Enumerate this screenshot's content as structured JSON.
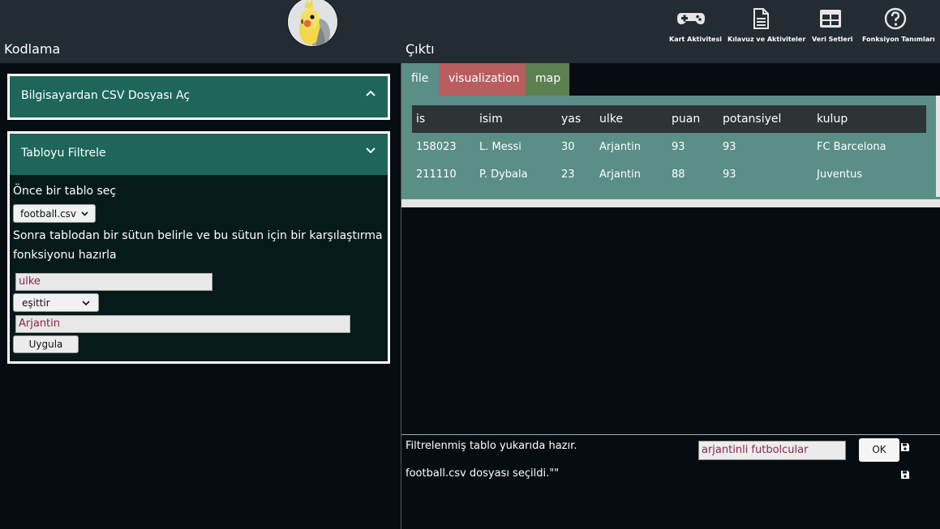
{
  "header": {
    "left_title": "Kodlama",
    "right_title": "Çıktı",
    "nav": [
      {
        "label": "Kart Aktivitesi",
        "icon": "gamepad-icon"
      },
      {
        "label": "Kılavuz ve Aktiviteler",
        "icon": "document-icon"
      },
      {
        "label": "Veri Setleri",
        "icon": "table-icon"
      },
      {
        "label": "Fonksiyon Tanımları",
        "icon": "help-circle-icon"
      }
    ]
  },
  "left": {
    "open_csv": {
      "title": "Bilgisayardan CSV Dosyası Aç"
    },
    "filter": {
      "title": "Tabloyu Filtrele",
      "step1": "Önce bir tablo seç",
      "table_select": "football.csv",
      "step2": "Sonra tablodan bir sütun belirle ve bu sütun için bir karşılaştırma fonksiyonu hazırla",
      "column_value": "ulke",
      "operator": "eşittir",
      "compare_value": "Arjantin",
      "apply": "Uygula"
    }
  },
  "right": {
    "tabs": [
      "file",
      "visualization",
      "map"
    ],
    "tab_colors": {
      "file": "#5a8e86",
      "visualization": "#b85e5e",
      "map": "#5d8050"
    },
    "table": {
      "columns": [
        "is",
        "isim",
        "yas",
        "ulke",
        "puan",
        "potansiyel",
        "kulup"
      ],
      "rows": [
        [
          "158023",
          "L. Messi",
          "30",
          "Arjantin",
          "93",
          "93",
          "FC Barcelona"
        ],
        [
          "211110",
          "P. Dybala",
          "23",
          "Arjantin",
          "88",
          "93",
          "Juventus"
        ]
      ]
    },
    "console": {
      "line1": "Filtrelenmiş tablo yukarıda hazır.",
      "input_value": "arjantinli futbolcular",
      "ok": "OK",
      "line2": "football.csv dosyası seçildi.\"\""
    }
  },
  "colors": {
    "accent": "#1d6659",
    "background": "#050d13",
    "header": "#232c33"
  }
}
